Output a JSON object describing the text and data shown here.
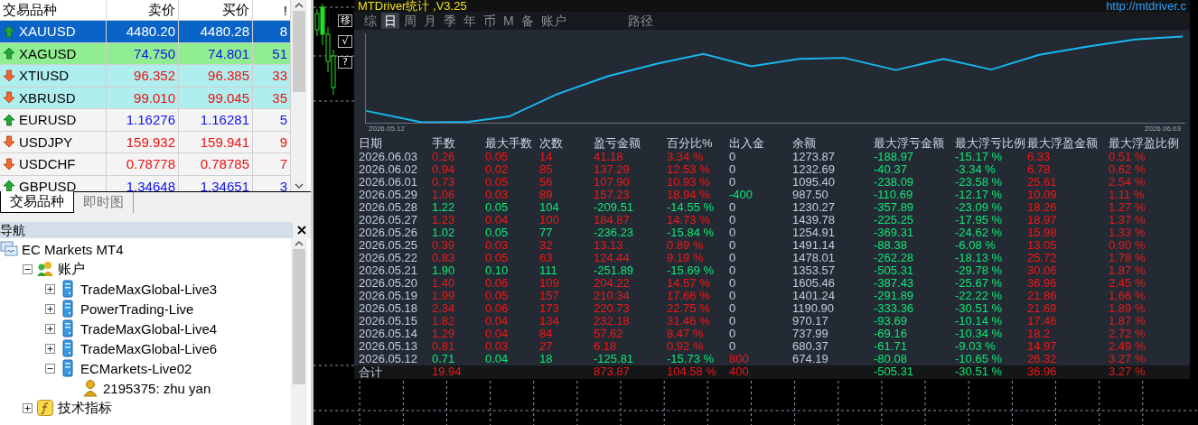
{
  "market_watch": {
    "columns": [
      "交易品种",
      "卖价",
      "买价",
      "!"
    ],
    "rows": [
      {
        "symbol": "XAUUSD",
        "bid": "4480.20",
        "ask": "4480.28",
        "spread": "8",
        "rising": true,
        "selected": true
      },
      {
        "symbol": "XAGUSD",
        "bid": "74.750",
        "ask": "74.801",
        "spread": "51",
        "rising": true,
        "selected": false,
        "color": "#90ee90"
      },
      {
        "symbol": "XTIUSD",
        "bid": "96.352",
        "ask": "96.385",
        "spread": "33",
        "rising": false,
        "selected": false,
        "color": "#afeeee"
      },
      {
        "symbol": "XBRUSD",
        "bid": "99.010",
        "ask": "99.045",
        "spread": "35",
        "rising": false,
        "selected": false,
        "color": "#afeeee"
      },
      {
        "symbol": "EURUSD",
        "bid": "1.16276",
        "ask": "1.16281",
        "spread": "5",
        "rising": true,
        "selected": false
      },
      {
        "symbol": "USDJPY",
        "bid": "159.932",
        "ask": "159.941",
        "spread": "9",
        "rising": false,
        "selected": false
      },
      {
        "symbol": "USDCHF",
        "bid": "0.78778",
        "ask": "0.78785",
        "spread": "7",
        "rising": false,
        "selected": false
      },
      {
        "symbol": "GBPUSD",
        "bid": "1.34648",
        "ask": "1.34651",
        "spread": "3",
        "rising": true,
        "selected": false
      }
    ],
    "tabs": [
      {
        "label": "交易品种",
        "selected": true
      },
      {
        "label": "即时图",
        "selected": false
      }
    ]
  },
  "navigator": {
    "title": "导航",
    "tree": [
      {
        "label": "EC Markets MT4",
        "kind": "root",
        "children": [
          {
            "label": "账户",
            "kind": "accounts",
            "expanded": true,
            "children": [
              {
                "label": "TradeMaxGlobal-Live3",
                "kind": "server",
                "expanded": false
              },
              {
                "label": "PowerTrading-Live",
                "kind": "server",
                "expanded": false
              },
              {
                "label": "TradeMaxGlobal-Live4",
                "kind": "server",
                "expanded": false
              },
              {
                "label": "TradeMaxGlobal-Live6",
                "kind": "server",
                "expanded": false
              },
              {
                "label": "ECMarkets-Live02",
                "kind": "server",
                "expanded": true,
                "children": [
                  {
                    "label": "2195375: zhu yan",
                    "kind": "account"
                  }
                ]
              }
            ]
          },
          {
            "label": "技术指标",
            "kind": "indicators",
            "expanded": false
          }
        ]
      }
    ]
  },
  "chart": {
    "buttons": [
      "移",
      "√",
      "?"
    ],
    "stats": {
      "title": "MTDriver统计 ,V3.25",
      "link": "http://mtdriver.c",
      "tabs": [
        {
          "label": "综",
          "selected": false
        },
        {
          "label": "日",
          "selected": true
        },
        {
          "label": "周",
          "selected": false
        },
        {
          "label": "月",
          "selected": false
        },
        {
          "label": "季",
          "selected": false
        },
        {
          "label": "年",
          "selected": false
        },
        {
          "label": "币",
          "selected": false
        },
        {
          "label": "M",
          "selected": false
        },
        {
          "label": "备",
          "selected": false
        },
        {
          "label": "账户",
          "selected": false
        }
      ],
      "path_tab": "路径",
      "curve": {
        "start_label": "2026.05.12",
        "end_label": "2026.06.03"
      },
      "columns": [
        "日期",
        "手数",
        "最大手数",
        "次数",
        "盈亏金额",
        "百分比%",
        "出入金",
        "余额",
        "最大浮亏金额",
        "最大浮亏比例",
        "最大浮盈金额",
        "最大浮盈比例"
      ],
      "rows": [
        {
          "date": "2026.06.03",
          "lots": "0.26",
          "max_lots": "0.05",
          "count": "14",
          "pnl": "41.18",
          "pct": "3.34 %",
          "cash": "0",
          "balance": "1273.87",
          "mfl": "-188.97",
          "mflp": "-15.17 %",
          "mfp": "6.33",
          "mfpp": "0.51 %",
          "loss": false,
          "cash_in": false,
          "cash_out": false
        },
        {
          "date": "2026.06.02",
          "lots": "0.94",
          "max_lots": "0.02",
          "count": "85",
          "pnl": "137.29",
          "pct": "12.53 %",
          "cash": "0",
          "balance": "1232.69",
          "mfl": "-40.37",
          "mflp": "-3.34 %",
          "mfp": "6.78",
          "mfpp": "0.62 %",
          "loss": false,
          "cash_in": false,
          "cash_out": false
        },
        {
          "date": "2026.06.01",
          "lots": "0.73",
          "max_lots": "0.05",
          "count": "56",
          "pnl": "107.90",
          "pct": "10.93 %",
          "cash": "0",
          "balance": "1095.40",
          "mfl": "-238.09",
          "mflp": "-23.58 %",
          "mfp": "25.61",
          "mfpp": "2.54 %",
          "loss": false,
          "cash_in": false,
          "cash_out": false
        },
        {
          "date": "2026.05.29",
          "lots": "1.06",
          "max_lots": "0.03",
          "count": "89",
          "pnl": "157.23",
          "pct": "18.94 %",
          "cash": "-400",
          "balance": "987.50",
          "mfl": "-110.69",
          "mflp": "-12.17 %",
          "mfp": "10.09",
          "mfpp": "1.11 %",
          "loss": false,
          "cash_in": false,
          "cash_out": true
        },
        {
          "date": "2026.05.28",
          "lots": "1.22",
          "max_lots": "0.05",
          "count": "104",
          "pnl": "-209.51",
          "pct": "-14.55 %",
          "cash": "0",
          "balance": "1230.27",
          "mfl": "-357.89",
          "mflp": "-23.09 %",
          "mfp": "18.26",
          "mfpp": "1.27 %",
          "loss": true,
          "cash_in": false,
          "cash_out": false
        },
        {
          "date": "2026.05.27",
          "lots": "1.23",
          "max_lots": "0.04",
          "count": "100",
          "pnl": "184.87",
          "pct": "14.73 %",
          "cash": "0",
          "balance": "1439.78",
          "mfl": "-225.25",
          "mflp": "-17.95 %",
          "mfp": "18.97",
          "mfpp": "1.37 %",
          "loss": false,
          "cash_in": false,
          "cash_out": false
        },
        {
          "date": "2026.05.26",
          "lots": "1.02",
          "max_lots": "0.05",
          "count": "77",
          "pnl": "-236.23",
          "pct": "-15.84 %",
          "cash": "0",
          "balance": "1254.91",
          "mfl": "-369.31",
          "mflp": "-24.62 %",
          "mfp": "15.98",
          "mfpp": "1.33 %",
          "loss": true,
          "cash_in": false,
          "cash_out": false
        },
        {
          "date": "2026.05.25",
          "lots": "0.39",
          "max_lots": "0.03",
          "count": "32",
          "pnl": "13.13",
          "pct": "0.89 %",
          "cash": "0",
          "balance": "1491.14",
          "mfl": "-88.38",
          "mflp": "-6.08 %",
          "mfp": "13.05",
          "mfpp": "0.90 %",
          "loss": false,
          "cash_in": false,
          "cash_out": false
        },
        {
          "date": "2026.05.22",
          "lots": "0.83",
          "max_lots": "0.05",
          "count": "63",
          "pnl": "124.44",
          "pct": "9.19 %",
          "cash": "0",
          "balance": "1478.01",
          "mfl": "-262.28",
          "mflp": "-18.13 %",
          "mfp": "25.72",
          "mfpp": "1.78 %",
          "loss": false,
          "cash_in": false,
          "cash_out": false
        },
        {
          "date": "2026.05.21",
          "lots": "1.90",
          "max_lots": "0.10",
          "count": "111",
          "pnl": "-251.89",
          "pct": "-15.69 %",
          "cash": "0",
          "balance": "1353.57",
          "mfl": "-505.31",
          "mflp": "-29.78 %",
          "mfp": "30.06",
          "mfpp": "1.87 %",
          "loss": true,
          "cash_in": false,
          "cash_out": false
        },
        {
          "date": "2026.05.20",
          "lots": "1.40",
          "max_lots": "0.06",
          "count": "109",
          "pnl": "204.22",
          "pct": "14.57 %",
          "cash": "0",
          "balance": "1605.46",
          "mfl": "-387.43",
          "mflp": "-25.67 %",
          "mfp": "36.96",
          "mfpp": "2.45 %",
          "loss": false,
          "cash_in": false,
          "cash_out": false
        },
        {
          "date": "2026.05.19",
          "lots": "1.99",
          "max_lots": "0.05",
          "count": "157",
          "pnl": "210.34",
          "pct": "17.66 %",
          "cash": "0",
          "balance": "1401.24",
          "mfl": "-291.89",
          "mflp": "-22.22 %",
          "mfp": "21.86",
          "mfpp": "1.66 %",
          "loss": false,
          "cash_in": false,
          "cash_out": false
        },
        {
          "date": "2026.05.18",
          "lots": "2.34",
          "max_lots": "0.06",
          "count": "173",
          "pnl": "220.73",
          "pct": "22.75 %",
          "cash": "0",
          "balance": "1190.90",
          "mfl": "-333.36",
          "mflp": "-30.51 %",
          "mfp": "21.69",
          "mfpp": "1.89 %",
          "loss": false,
          "cash_in": false,
          "cash_out": false
        },
        {
          "date": "2026.05.15",
          "lots": "1.82",
          "max_lots": "0.04",
          "count": "134",
          "pnl": "232.18",
          "pct": "31.46 %",
          "cash": "0",
          "balance": "970.17",
          "mfl": "-93.69",
          "mflp": "-10.14 %",
          "mfp": "17.46",
          "mfpp": "1.87 %",
          "loss": false,
          "cash_in": false,
          "cash_out": false
        },
        {
          "date": "2026.05.14",
          "lots": "1.29",
          "max_lots": "0.04",
          "count": "84",
          "pnl": "57.62",
          "pct": "8.47 %",
          "cash": "0",
          "balance": "737.99",
          "mfl": "-69.16",
          "mflp": "-10.34 %",
          "mfp": "18.2",
          "mfpp": "2.72 %",
          "loss": false,
          "cash_in": false,
          "cash_out": false
        },
        {
          "date": "2026.05.13",
          "lots": "0.81",
          "max_lots": "0.03",
          "count": "27",
          "pnl": "6.18",
          "pct": "0.92 %",
          "cash": "0",
          "balance": "680.37",
          "mfl": "-61.71",
          "mflp": "-9.03 %",
          "mfp": "14.97",
          "mfpp": "2.49 %",
          "loss": false,
          "cash_in": false,
          "cash_out": false
        },
        {
          "date": "2026.05.12",
          "lots": "0.71",
          "max_lots": "0.04",
          "count": "18",
          "pnl": "-125.81",
          "pct": "-15.73 %",
          "cash": "800",
          "balance": "674.19",
          "mfl": "-80.08",
          "mflp": "-10.65 %",
          "mfp": "26.32",
          "mfpp": "3.27 %",
          "loss": true,
          "cash_in": true,
          "cash_out": false
        }
      ],
      "total": {
        "label": "合计",
        "lots": "19.94",
        "pnl": "873.87",
        "pct": "104.58 %",
        "cash": "400",
        "mfl": "-505.31",
        "mflp": "-30.51 %",
        "mfp": "36.96",
        "mfpp": "3.27 %"
      }
    }
  }
}
